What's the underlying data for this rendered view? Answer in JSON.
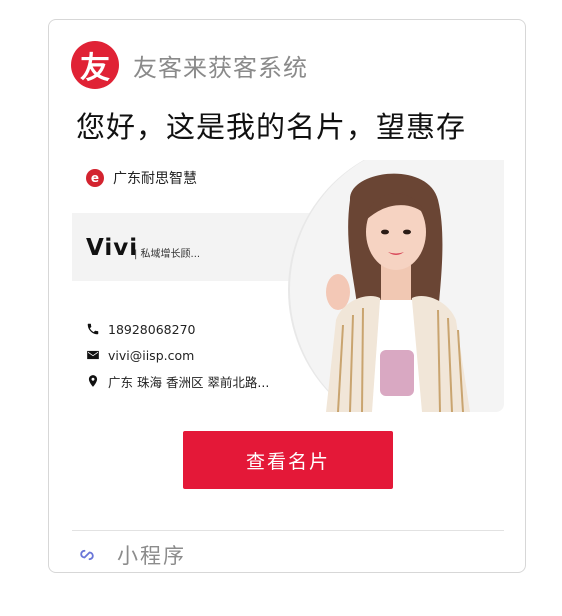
{
  "header": {
    "logo_glyph": "友",
    "app_name": "友客来获客系统"
  },
  "title": "您好，这是我的名片，望惠存",
  "card": {
    "company_name": "广东耐思智慧",
    "company_logo_glyph": "e",
    "person_name": "Vivi",
    "person_role": "| 私域增长顾...",
    "phone": "18928068270",
    "email": "vivi@iisp.com",
    "address": "广东 珠海 香洲区 翠前北路..."
  },
  "cta_label": "查看名片",
  "footer": {
    "label": "小程序",
    "icon": "mini-program-link-icon"
  },
  "colors": {
    "brand_red": "#e02235",
    "cta_red": "#e41838"
  }
}
